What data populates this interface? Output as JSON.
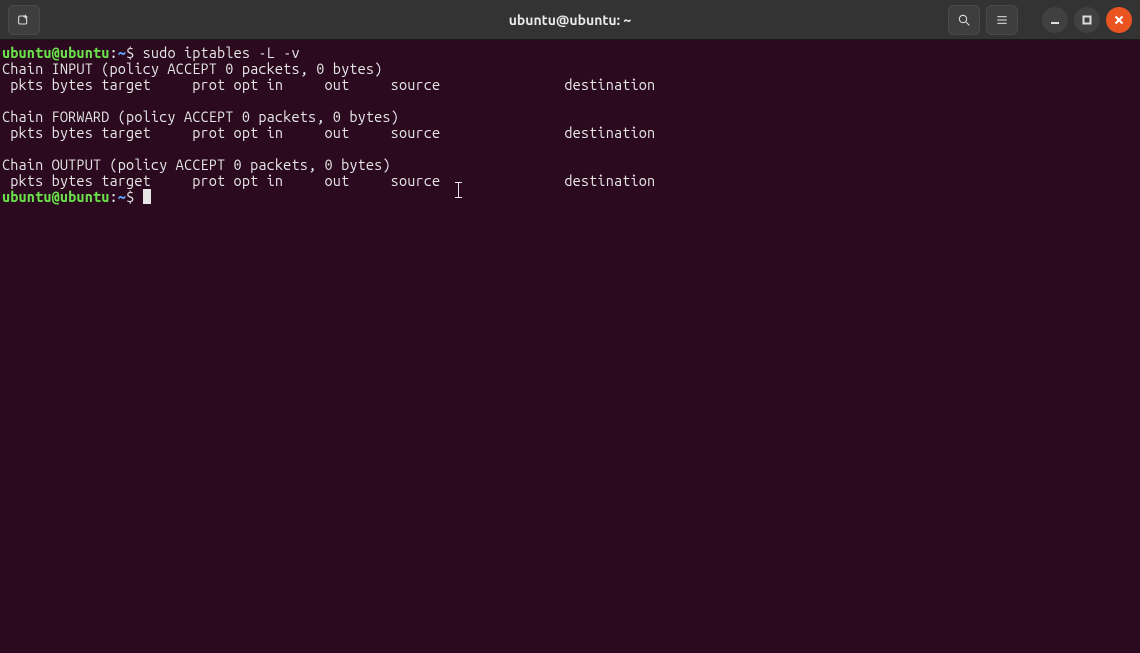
{
  "window": {
    "title": "ubuntu@ubuntu: ~"
  },
  "prompt": {
    "user_host": "ubuntu@ubuntu",
    "colon": ":",
    "path": "~",
    "dollar": "$"
  },
  "cmd1": " sudo iptables -L -v",
  "output": {
    "chain_input_header": "Chain INPUT (policy ACCEPT 0 packets, 0 bytes)",
    "columns_line": " pkts bytes target     prot opt in     out     source               destination",
    "blank": "",
    "chain_forward_header": "Chain FORWARD (policy ACCEPT 0 packets, 0 bytes)",
    "chain_output_header": "Chain OUTPUT (policy ACCEPT 0 packets, 0 bytes)"
  },
  "icons": {
    "newtab": "new-tab-icon",
    "search": "search-icon",
    "menu": "hamburger-menu-icon",
    "minimize": "minimize-icon",
    "maximize": "maximize-icon",
    "close": "close-icon"
  }
}
